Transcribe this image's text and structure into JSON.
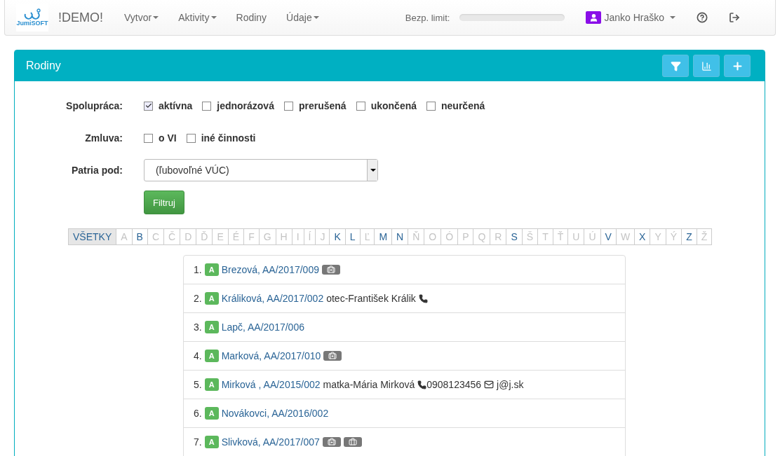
{
  "navbar": {
    "logo_text": "JumiSOFT",
    "brand": "!DEMO!",
    "menu": [
      {
        "label": "Vytvor",
        "dropdown": true
      },
      {
        "label": "Aktivity",
        "dropdown": true
      },
      {
        "label": "Rodiny",
        "dropdown": false
      },
      {
        "label": "Údaje",
        "dropdown": true
      }
    ],
    "limit": {
      "label": "Bezp. limit:",
      "level": 0
    },
    "user": {
      "name": "Janko Hraško"
    }
  },
  "panel": {
    "title": "Rodiny",
    "filters": {
      "spolupraca": {
        "label": "Spolupráca:",
        "options": [
          {
            "label": "aktívna",
            "checked": true
          },
          {
            "label": "jednorázová",
            "checked": false
          },
          {
            "label": "prerušená",
            "checked": false
          },
          {
            "label": "ukončená",
            "checked": false
          },
          {
            "label": "neurčená",
            "checked": false
          }
        ]
      },
      "zmluva": {
        "label": "Zmluva:",
        "options": [
          {
            "label": "o VI",
            "checked": false
          },
          {
            "label": "iné činnosti",
            "checked": false
          }
        ]
      },
      "patria_pod": {
        "label": "Patria pod:",
        "value": "(ľubovoľné VÚC)"
      },
      "button": "Filtruj"
    },
    "letters": [
      {
        "label": "VŠETKY",
        "selected": true,
        "disabled": false
      },
      {
        "label": "A",
        "selected": false,
        "disabled": true
      },
      {
        "label": "B",
        "selected": false,
        "disabled": false
      },
      {
        "label": "C",
        "selected": false,
        "disabled": true
      },
      {
        "label": "Č",
        "selected": false,
        "disabled": true
      },
      {
        "label": "D",
        "selected": false,
        "disabled": true
      },
      {
        "label": "Ď",
        "selected": false,
        "disabled": true
      },
      {
        "label": "E",
        "selected": false,
        "disabled": true
      },
      {
        "label": "É",
        "selected": false,
        "disabled": true
      },
      {
        "label": "F",
        "selected": false,
        "disabled": true
      },
      {
        "label": "G",
        "selected": false,
        "disabled": true
      },
      {
        "label": "H",
        "selected": false,
        "disabled": true
      },
      {
        "label": "I",
        "selected": false,
        "disabled": true
      },
      {
        "label": "Í",
        "selected": false,
        "disabled": true
      },
      {
        "label": "J",
        "selected": false,
        "disabled": true
      },
      {
        "label": "K",
        "selected": false,
        "disabled": false
      },
      {
        "label": "L",
        "selected": false,
        "disabled": false
      },
      {
        "label": "Ľ",
        "selected": false,
        "disabled": true
      },
      {
        "label": "M",
        "selected": false,
        "disabled": false
      },
      {
        "label": "N",
        "selected": false,
        "disabled": false
      },
      {
        "label": "Ň",
        "selected": false,
        "disabled": true
      },
      {
        "label": "O",
        "selected": false,
        "disabled": true
      },
      {
        "label": "Ó",
        "selected": false,
        "disabled": true
      },
      {
        "label": "P",
        "selected": false,
        "disabled": true
      },
      {
        "label": "Q",
        "selected": false,
        "disabled": true
      },
      {
        "label": "R",
        "selected": false,
        "disabled": true
      },
      {
        "label": "S",
        "selected": false,
        "disabled": false
      },
      {
        "label": "Š",
        "selected": false,
        "disabled": true
      },
      {
        "label": "T",
        "selected": false,
        "disabled": true
      },
      {
        "label": "Ť",
        "selected": false,
        "disabled": true
      },
      {
        "label": "U",
        "selected": false,
        "disabled": true
      },
      {
        "label": "Ú",
        "selected": false,
        "disabled": true
      },
      {
        "label": "V",
        "selected": false,
        "disabled": false
      },
      {
        "label": "W",
        "selected": false,
        "disabled": true
      },
      {
        "label": "X",
        "selected": false,
        "disabled": false
      },
      {
        "label": "Y",
        "selected": false,
        "disabled": true
      },
      {
        "label": "Ý",
        "selected": false,
        "disabled": true
      },
      {
        "label": "Z",
        "selected": false,
        "disabled": false
      },
      {
        "label": "Ž",
        "selected": false,
        "disabled": true
      }
    ],
    "families": [
      {
        "number": "1.",
        "badge": "A",
        "name": "Brezová, AA/2017/009",
        "tags": [
          {
            "kind": "medical"
          }
        ]
      },
      {
        "number": "2.",
        "badge": "A",
        "name": "Králiková, AA/2017/002",
        "parts": [
          {
            "kind": "text",
            "text": "otec-František Králik"
          },
          {
            "kind": "phone"
          }
        ]
      },
      {
        "number": "3.",
        "badge": "A",
        "name": "Lapč, AA/2017/006"
      },
      {
        "number": "4.",
        "badge": "A",
        "name": "Marková, AA/2017/010",
        "tags": [
          {
            "kind": "medical"
          }
        ]
      },
      {
        "number": "5.",
        "badge": "A",
        "name": "Mirková , AA/2015/002",
        "parts": [
          {
            "kind": "text",
            "text": "matka-Mária Mirková"
          },
          {
            "kind": "phone",
            "text": "0908123456"
          },
          {
            "kind": "email",
            "text": "j@j.sk"
          }
        ]
      },
      {
        "number": "6.",
        "badge": "A",
        "name": "Novákovci, AA/2016/002"
      },
      {
        "number": "7.",
        "badge": "A",
        "name": "Slivková, AA/2017/007",
        "tags": [
          {
            "kind": "medical"
          },
          {
            "kind": "work"
          }
        ]
      }
    ]
  }
}
